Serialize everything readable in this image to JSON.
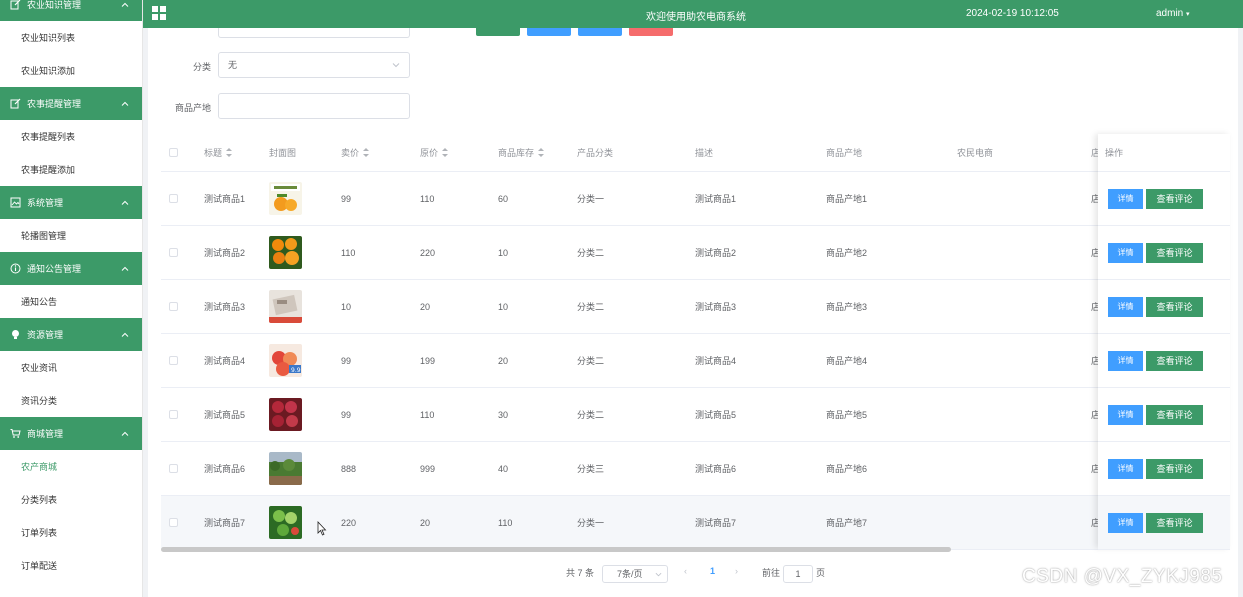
{
  "sidebar": {
    "groups": [
      {
        "title": "农业知识管理",
        "icon": "edit-icon",
        "items": [
          {
            "label": "农业知识列表"
          },
          {
            "label": "农业知识添加"
          }
        ]
      },
      {
        "title": "农事提醒管理",
        "icon": "edit-icon",
        "items": [
          {
            "label": "农事提醒列表"
          },
          {
            "label": "农事提醒添加"
          }
        ]
      },
      {
        "title": "系统管理",
        "icon": "image-icon",
        "items": [
          {
            "label": "轮播图管理"
          }
        ]
      },
      {
        "title": "通知公告管理",
        "icon": "info-icon",
        "items": [
          {
            "label": "通知公告"
          }
        ]
      },
      {
        "title": "资源管理",
        "icon": "bulb-icon",
        "items": [
          {
            "label": "农业资讯"
          },
          {
            "label": "资讯分类"
          }
        ]
      },
      {
        "title": "商城管理",
        "icon": "cart-icon",
        "items": [
          {
            "label": "农产商城",
            "active": true
          },
          {
            "label": "分类列表"
          },
          {
            "label": "订单列表"
          },
          {
            "label": "订单配送"
          }
        ]
      }
    ]
  },
  "topbar": {
    "title": "欢迎使用助农电商系统",
    "datetime": "2024-02-19 10:12:05",
    "user": "admin"
  },
  "filters": {
    "category_label": "分类",
    "category_value": "无",
    "origin_label": "商品产地",
    "origin_value": ""
  },
  "table": {
    "headers": {
      "title": "标题",
      "cover": "封面图",
      "price": "卖价",
      "original_price": "原价",
      "stock": "商品库存",
      "category": "产品分类",
      "description": "描述",
      "origin": "商品产地",
      "farmer": "农民电商",
      "shop_partial": "店",
      "actions": "操作"
    },
    "rows": [
      {
        "title": "测试商品1",
        "price": "99",
        "original_price": "110",
        "stock": "60",
        "category": "分类一",
        "description": "测试商品1",
        "origin": "商品产地1",
        "shop_partial": "店",
        "thumb": "banner-oranges"
      },
      {
        "title": "测试商品2",
        "price": "110",
        "original_price": "220",
        "stock": "10",
        "category": "分类二",
        "description": "测试商品2",
        "origin": "商品产地2",
        "shop_partial": "店",
        "thumb": "oranges"
      },
      {
        "title": "测试商品3",
        "price": "10",
        "original_price": "20",
        "stock": "10",
        "category": "分类二",
        "description": "测试商品3",
        "origin": "商品产地3",
        "shop_partial": "店",
        "thumb": "product-box"
      },
      {
        "title": "测试商品4",
        "price": "99",
        "original_price": "199",
        "stock": "20",
        "category": "分类二",
        "description": "测试商品4",
        "origin": "商品产地4",
        "shop_partial": "店",
        "thumb": "peaches",
        "thumb_tag": "9.9"
      },
      {
        "title": "测试商品5",
        "price": "99",
        "original_price": "110",
        "stock": "30",
        "category": "分类二",
        "description": "测试商品5",
        "origin": "商品产地5",
        "shop_partial": "店",
        "thumb": "apples"
      },
      {
        "title": "测试商品6",
        "price": "888",
        "original_price": "999",
        "stock": "40",
        "category": "分类三",
        "description": "测试商品6",
        "origin": "商品产地6",
        "shop_partial": "店",
        "thumb": "orchard"
      },
      {
        "title": "测试商品7",
        "price": "220",
        "original_price": "20",
        "stock": "110",
        "category": "分类一",
        "description": "测试商品7",
        "origin": "商品产地7",
        "shop_partial": "店",
        "thumb": "green-fruit"
      }
    ],
    "detail_label": "详情",
    "review_label": "查看评论"
  },
  "pagination": {
    "total": "共 7 条",
    "page_size": "7条/页",
    "current_page": "1",
    "goto_label": "前往",
    "goto_value": "1",
    "page_suffix": "页"
  },
  "watermark": "CSDN @VX_ZYKJ985",
  "colors": {
    "primary_green": "#3c9a68",
    "detail_blue": "#409eff",
    "danger": "#f56c6c"
  }
}
